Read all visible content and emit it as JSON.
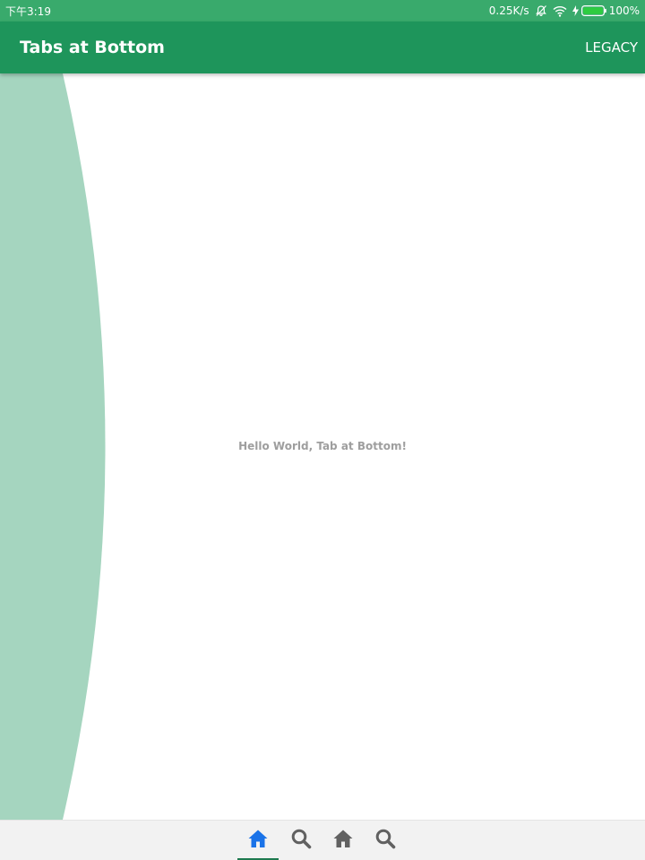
{
  "status_bar": {
    "time": "下午3:19",
    "network_speed": "0.25K/s",
    "battery_percent": "100%",
    "icons": [
      "mute-bell-icon",
      "wifi-icon",
      "charging-bolt-icon",
      "battery-icon"
    ]
  },
  "app_bar": {
    "title": "Tabs at Bottom",
    "action_label": "LEGACY"
  },
  "main": {
    "message": "Hello World, Tab at Bottom!"
  },
  "bottom_tabs": {
    "selected_index": 0,
    "items": [
      {
        "icon": "home-icon",
        "color": "#1a73e8"
      },
      {
        "icon": "search-icon",
        "color": "#616161"
      },
      {
        "icon": "home-icon",
        "color": "#616161"
      },
      {
        "icon": "search-icon",
        "color": "#616161"
      }
    ]
  },
  "colors": {
    "status_bar": "#39aa6c",
    "app_bar": "#1e955b",
    "decor_arc": "#a5d5bf",
    "active_tab": "#1a73e8",
    "inactive_tab": "#616161"
  }
}
